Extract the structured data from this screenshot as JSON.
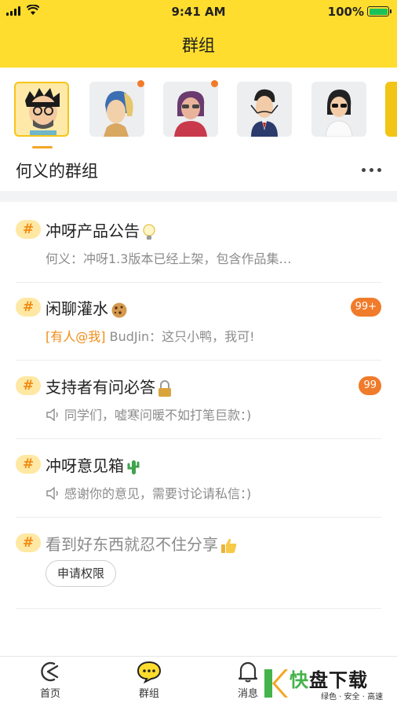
{
  "status_bar": {
    "time": "9:41 AM",
    "battery_pct": "100%",
    "battery_level": 1.0
  },
  "header": {
    "title": "群组"
  },
  "avatars": [
    {
      "name": "avatar-1",
      "selected": true,
      "has_dot": false
    },
    {
      "name": "avatar-2",
      "selected": false,
      "has_dot": true
    },
    {
      "name": "avatar-3",
      "selected": false,
      "has_dot": true
    },
    {
      "name": "avatar-4",
      "selected": false,
      "has_dot": false
    },
    {
      "name": "avatar-5",
      "selected": false,
      "has_dot": false
    }
  ],
  "section": {
    "title": "何义的群组"
  },
  "groups": [
    {
      "hash": "#",
      "name": "冲呀产品公告",
      "emoji": "bulb-icon",
      "subtitle": "何义：冲呀1.3版本已经上架，包含作品集…"
    },
    {
      "hash": "#",
      "name": "闲聊灌水",
      "emoji": "cookie-icon",
      "mention": "[有人@我]",
      "subtitle": " BudJin：这只小鸭，我可!",
      "badge": "99+"
    },
    {
      "hash": "#",
      "name": "支持者有问必答",
      "emoji": "lock-icon",
      "subtitle": "同学们，嘘寒问暖不如打笔巨款：)",
      "badge": "99"
    },
    {
      "hash": "#",
      "name": "冲呀意见箱",
      "emoji": "cactus-icon",
      "subtitle": "感谢你的意见，需要讨论请私信：)"
    },
    {
      "hash": "#",
      "name": "看到好东西就忍不住分享",
      "emoji": "thumbs-up-icon",
      "button": "申请权限"
    }
  ],
  "tabbar": {
    "home": "首页",
    "groups": "群组",
    "messages": "消息"
  },
  "watermark": {
    "brand_a": "快",
    "brand_b": "盘下载",
    "slogan": "绿色 · 安全 · 高速"
  },
  "colors": {
    "accent": "#FFDD2E",
    "badge": "#F07B2A",
    "hash_bg": "#FFE8A3",
    "hash_fg": "#F08C17"
  }
}
